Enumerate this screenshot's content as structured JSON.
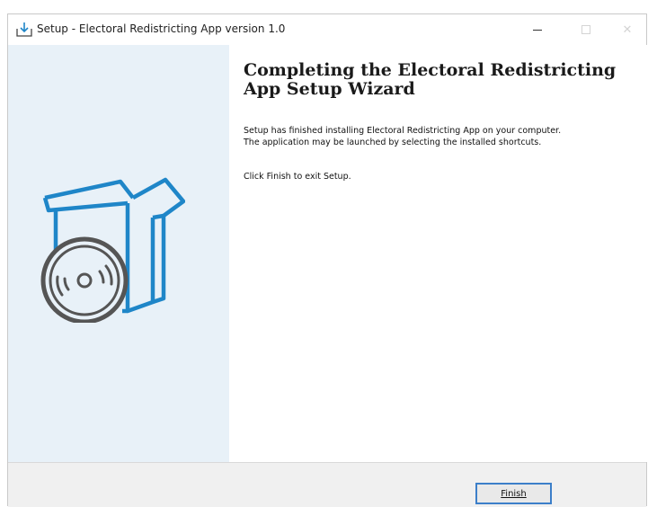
{
  "window": {
    "title": "Setup - Electoral Redistricting App version 1.0",
    "app_icon": "installer-icon",
    "controls": {
      "minimize": "minimize-icon",
      "maximize": "maximize-icon",
      "close": "close-icon",
      "close_glyph": "✕"
    }
  },
  "sidebar": {
    "illustration": "software-box-with-disc-icon",
    "colors": {
      "background": "#e8f1f8",
      "line": "#1f86c8",
      "disc": "#555555"
    }
  },
  "content": {
    "heading_line1": "Completing the Electoral Redistricting",
    "heading_line2": "App Setup Wizard",
    "paragraph_line1": "Setup has finished installing Electoral Redistricting App on your computer.",
    "paragraph_line2": "The application may be launched by selecting the installed shortcuts.",
    "exit_text": "Click Finish to exit Setup."
  },
  "footer": {
    "finish_label": "Finish",
    "focus_color": "#3c7fc9"
  }
}
